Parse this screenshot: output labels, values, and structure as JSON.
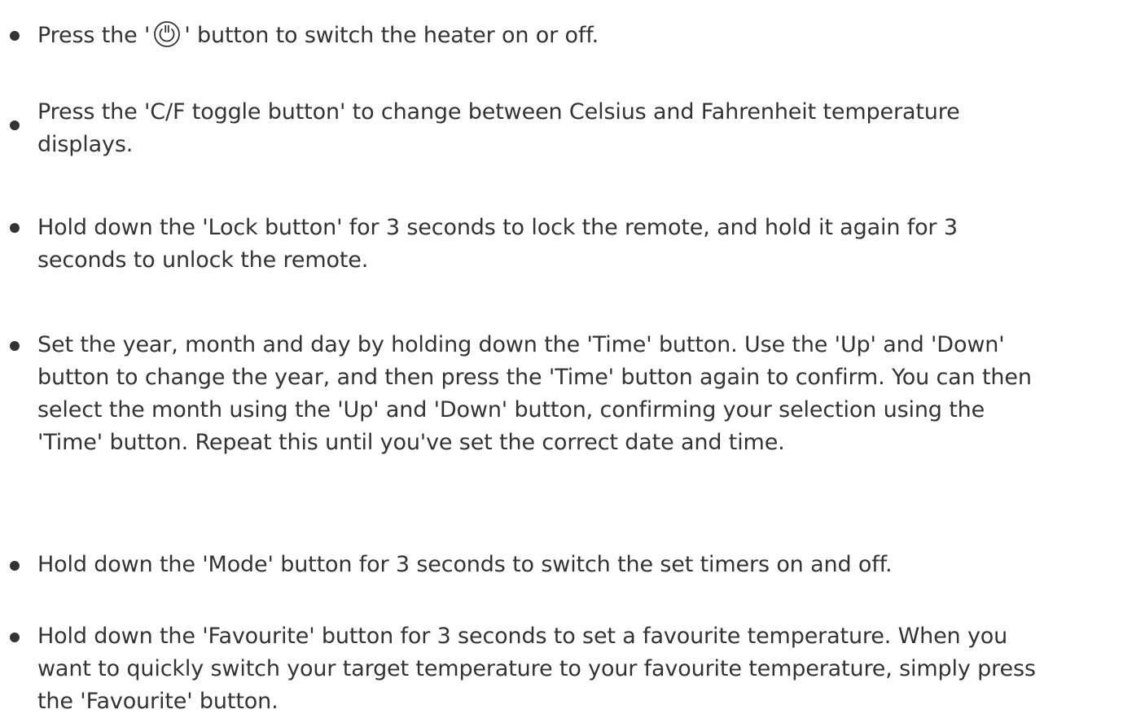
{
  "items": [
    {
      "lines": [
        "' button to switch the heater on or off."
      ],
      "prefix": "Press the '",
      "icon": "power-icon"
    },
    {
      "lines": [
        "Press the 'C/F toggle button' to change between Celsius and Fahrenheit temperature",
        "displays."
      ]
    },
    {
      "lines": [
        "Hold down the 'Lock button' for 3 seconds to lock the remote, and hold it again for 3",
        "seconds to unlock the remote."
      ]
    },
    {
      "lines": [
        "Set the year, month and day by holding down the 'Time' button. Use the 'Up' and 'Down'",
        "button to change the year, and then press the 'Time' button again to confirm. You can then",
        "select the month using the 'Up' and 'Down' button, confirming your selection using the",
        "'Time' button. Repeat this until you've set the correct date and time."
      ]
    },
    {
      "lines": [
        "Hold down the 'Mode' button for 3 seconds to switch the set timers on and off."
      ]
    },
    {
      "lines": [
        "Hold down the 'Favourite' button for 3 seconds to set a favourite temperature. When you",
        "want to quickly switch your target temperature to your favourite temperature, simply press",
        "the 'Favourite' button."
      ]
    }
  ]
}
